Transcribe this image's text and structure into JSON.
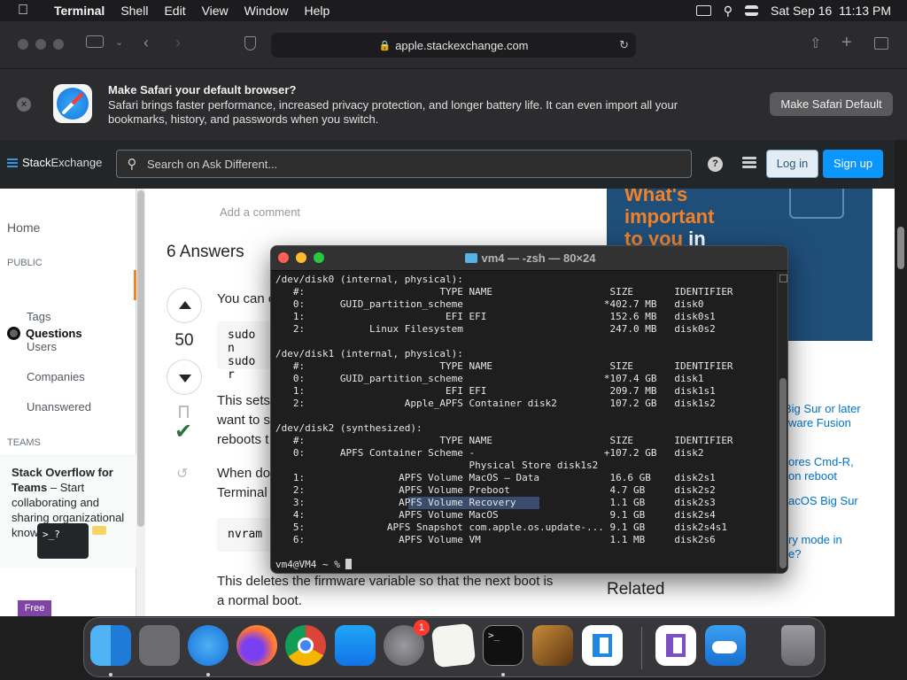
{
  "menubar": {
    "app_name": "Terminal",
    "items": [
      "Shell",
      "Edit",
      "View",
      "Window",
      "Help"
    ],
    "datetime": "Sat Sep 16  11:13 PM"
  },
  "safari": {
    "url": "apple.stackexchange.com"
  },
  "banner": {
    "title": "Make Safari your default browser?",
    "text": "Safari brings faster performance, increased privacy protection, and longer battery life. It can even import all your bookmarks, history, and passwords when you switch.",
    "button": "Make Safari Default",
    "close": "×"
  },
  "se": {
    "logo_a": "Stack",
    "logo_b": "Exchange",
    "search_placeholder": "Search on Ask Different...",
    "help": "?",
    "login": "Log in",
    "signup": "Sign up"
  },
  "nav": {
    "home": "Home",
    "public": "PUBLIC",
    "questions": "Questions",
    "tags": "Tags",
    "users": "Users",
    "companies": "Companies",
    "unanswered": "Unanswered",
    "teams": "TEAMS",
    "teams_title": "Stack Overflow for Teams",
    "teams_text": " – Start collaborating and sharing organizational knowledge.",
    "teams_img": ">_?",
    "free": "Free"
  },
  "main": {
    "add_comment": "Add a comment",
    "answers_title": "6 Answers",
    "vote_count": "50",
    "answer_p1": "You can c",
    "code1_l1": "sudo n",
    "code1_l2": "sudo r",
    "answer_p2_l1": "This sets",
    "answer_p2_l2": "want to s",
    "answer_p2_l3": "reboots t",
    "answer_p3_l1": "When do",
    "answer_p3_l2": "Terminal",
    "code2": "nvram",
    "answer_p4_l1": "This deletes the firmware variable so that the next boot is",
    "answer_p4_l2": "a normal boot."
  },
  "right": {
    "ad_l1": "What's",
    "ad_l2": "important",
    "ad_l3a": "to you ",
    "ad_l3b": "in",
    "links": [
      "Big Sur or later",
      "ware Fusion",
      "ores Cmd-R,",
      "on reboot",
      "acOS Big Sur",
      "ry mode in",
      "e?"
    ],
    "related": "Related"
  },
  "terminal": {
    "title": "vm4 — -zsh — 80×24",
    "lines": [
      "/dev/disk0 (internal, physical):",
      "   #:                       TYPE NAME                    SIZE       IDENTIFIER",
      "   0:      GUID_partition_scheme                        *402.7 MB   disk0",
      "   1:                        EFI EFI                     152.6 MB   disk0s1",
      "   2:           Linux Filesystem                         247.0 MB   disk0s2",
      "",
      "/dev/disk1 (internal, physical):",
      "   #:                       TYPE NAME                    SIZE       IDENTIFIER",
      "   0:      GUID_partition_scheme                        *107.4 GB   disk1",
      "   1:                        EFI EFI                     209.7 MB   disk1s1",
      "   2:                 Apple_APFS Container disk2         107.2 GB   disk1s2",
      "",
      "/dev/disk2 (synthesized):",
      "   #:                       TYPE NAME                    SIZE       IDENTIFIER",
      "   0:      APFS Container Scheme -                      +107.2 GB   disk2",
      "                                 Physical Store disk1s2",
      "   1:                APFS Volume MacOS — Data            16.6 GB    disk2s1",
      "   2:                APFS Volume Preboot                 4.7 GB     disk2s2",
      "   3:                APFS Volume Recovery                1.1 GB     disk2s3",
      "   4:                APFS Volume MacOS                   9.1 GB     disk2s4",
      "   5:              APFS Snapshot com.apple.os.update-... 9.1 GB     disk2s4s1",
      "   6:                APFS Volume VM                      1.1 MB     disk2s6",
      "",
      "vm4@VM4 ~ % "
    ]
  },
  "dock": {
    "apps": [
      "finder-icon",
      "launchpad-icon",
      "safari-icon",
      "firefox-icon",
      "chrome-icon",
      "app-store-icon",
      "system-preferences-icon",
      "textedit-icon",
      "terminal-icon",
      "garageband-icon",
      "vscode-icon",
      "visual-studio-icon",
      "weather-icon",
      "trash-icon"
    ],
    "badge": "1",
    "terminal_glyph": ">_"
  },
  "colors": {
    "accent": "#0a95ff",
    "terminal_bg": "#1e1e1e",
    "ad_bg": "#1f4e79",
    "ad_orange": "#f48225"
  }
}
